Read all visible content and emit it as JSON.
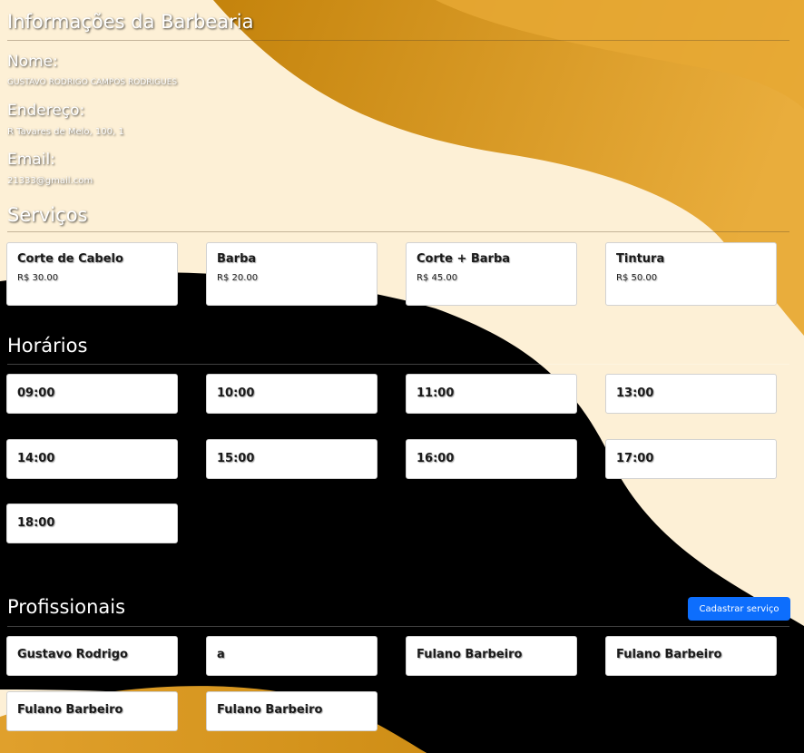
{
  "info": {
    "title": "Informações da Barbearia",
    "nome_label": "Nome:",
    "nome_value": "GUSTAVO RODRIGO CAMPOS RODRIGUES",
    "endereco_label": "Endereço:",
    "endereco_value": "R Tavares de Melo, 100, 1",
    "email_label": "Email:",
    "email_value": "21333@gmail.com"
  },
  "servicos": {
    "title": "Serviços",
    "items": [
      {
        "name": "Corte de Cabelo",
        "price": "R$ 30.00"
      },
      {
        "name": "Barba",
        "price": "R$ 20.00"
      },
      {
        "name": "Corte + Barba",
        "price": "R$ 45.00"
      },
      {
        "name": "Tintura",
        "price": "R$ 50.00"
      }
    ]
  },
  "horarios": {
    "title": "Horários",
    "items": [
      "09:00",
      "10:00",
      "11:00",
      "13:00",
      "14:00",
      "15:00",
      "16:00",
      "17:00",
      "18:00"
    ]
  },
  "profissionais": {
    "title": "Profissionais",
    "button_label": "Cadastrar serviço",
    "items": [
      "Gustavo Rodrigo",
      "a",
      "Fulano Barbeiro",
      "Fulano Barbeiro",
      "Fulano Barbeiro",
      "Fulano Barbeiro"
    ]
  },
  "colors": {
    "cream": "#fdf0d6",
    "gold_dark": "#c4830c",
    "gold_light": "#e8ab3a",
    "black": "#000000",
    "button_blue": "#0d6efd"
  }
}
